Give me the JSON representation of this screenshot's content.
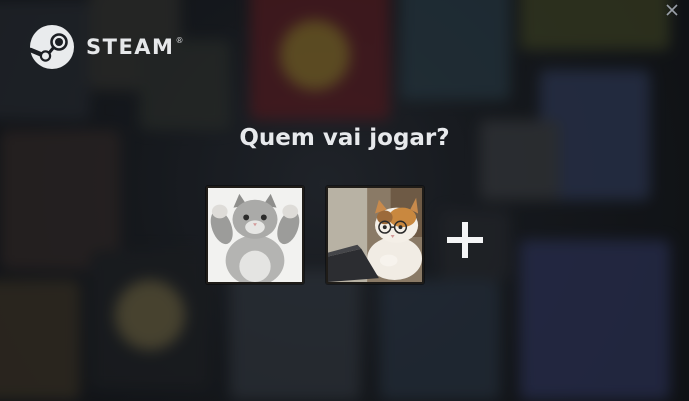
{
  "window": {
    "close_icon": "close-icon"
  },
  "brand": {
    "name": "STEAM",
    "registered_mark": "®",
    "logo_icon": "steam-logo-icon"
  },
  "prompt": {
    "title": "Quem vai jogar?"
  },
  "accounts": [
    {
      "avatar": "cat-flexing-avatar",
      "background": "#f2f2f0"
    },
    {
      "avatar": "cat-with-glasses-laptop-avatar",
      "background": "#7a6a58"
    }
  ],
  "add_account": {
    "icon": "plus-icon"
  },
  "colors": {
    "text": "#e7e9ec",
    "background": "#1b1e23"
  }
}
